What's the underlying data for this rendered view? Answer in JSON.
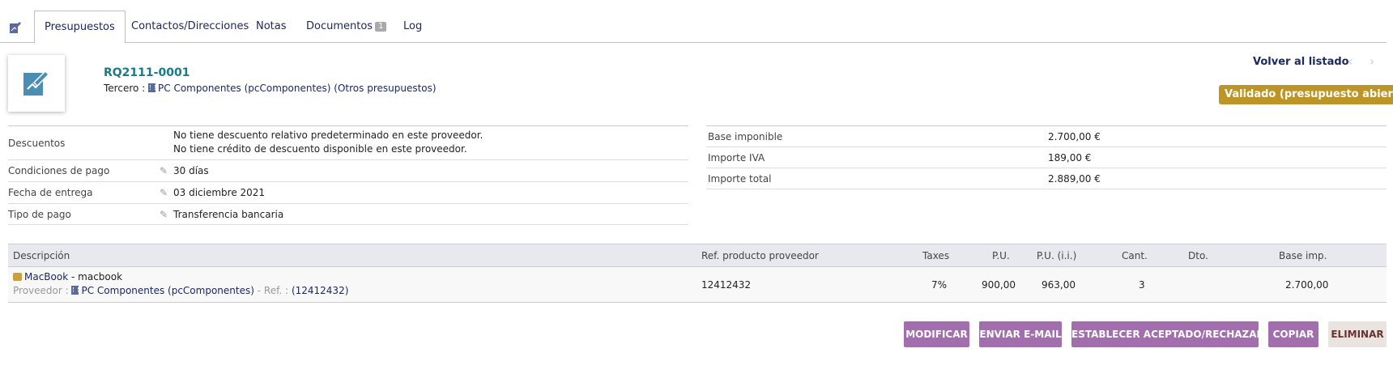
{
  "tabs": [
    {
      "label": "Presupuestos"
    },
    {
      "label": "Contactos/Direcciones"
    },
    {
      "label": "Notas"
    },
    {
      "label": "Documentos",
      "badge": "1"
    },
    {
      "label": "Log"
    }
  ],
  "header": {
    "ref": "RQ2111-0001",
    "third_label": "Tercero :",
    "third_name": "PC Componentes (pcComponentes)",
    "third_extra": "(Otros presupuestos)",
    "back_label": "Volver al listado",
    "prev_icon": "chevron-left-icon",
    "next_icon": "chevron-right-icon",
    "status": "Validado (presupuesto abierto)",
    "status_color": "#bc9526"
  },
  "details": {
    "discounts_label": "Descuentos",
    "discount_line1": "No tiene descuento relativo predeterminado en este proveedor.",
    "discount_line2": "No tiene crédito de descuento disponible en este proveedor.",
    "payment_terms_label": "Condiciones de pago",
    "payment_terms_value": "30 días",
    "delivery_date_label": "Fecha de entrega",
    "delivery_date_value": "03 diciembre 2021",
    "payment_type_label": "Tipo de pago",
    "payment_type_value": "Transferencia bancaria"
  },
  "totals": {
    "base_label": "Base imponible",
    "base_value": "2.700,00 €",
    "vat_label": "Importe IVA",
    "vat_value": "189,00 €",
    "total_label": "Importe total",
    "total_value": "2.889,00 €"
  },
  "lines": {
    "headers": {
      "description": "Descripción",
      "supplier_ref": "Ref. producto proveedor",
      "taxes": "Taxes",
      "unit_price": "P.U.",
      "unit_price_tax": "P.U. (i.i.)",
      "qty": "Cant.",
      "discount": "Dto.",
      "base": "Base imp."
    },
    "rows": [
      {
        "product_ref": "MacBook",
        "product_name": "- macbook",
        "supplier_label": "Proveedor :",
        "supplier_name": "PC Componentes (pcComponentes)",
        "ref_label": "- Ref. :",
        "ref_value": "(12412432)",
        "supplier_ref": "12412432",
        "taxes": "7%",
        "unit_price": "900,00",
        "unit_price_tax": "963,00",
        "qty": "3",
        "discount": "",
        "base": "2.700,00"
      }
    ]
  },
  "actions": {
    "modify": "MODIFICAR",
    "send_email": "ENVIAR E-MAIL",
    "set_status": "ESTABLECER ACEPTADO/RECHAZADO",
    "copy": "COPIAR",
    "delete": "ELIMINAR"
  },
  "colors": {
    "accent": "#a26ead",
    "title": "#1b7a83",
    "link": "#1c2960"
  }
}
